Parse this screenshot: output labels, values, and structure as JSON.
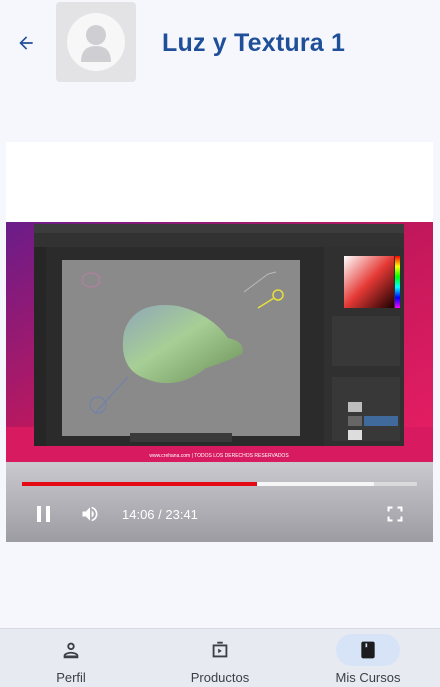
{
  "header": {
    "title": "Luz y Textura 1",
    "back_icon": "arrow-back-icon",
    "avatar_icon": "person-placeholder-icon"
  },
  "video": {
    "current_time": "14:06",
    "duration": "23:41",
    "time_display": "14:06 / 23:41",
    "progress_fraction": 0.595,
    "buffered_fraction": 0.89,
    "state": "playing",
    "footer_caption": "www.crehana.com | TODOS LOS DERECHOS RESERVADOS"
  },
  "bottom_nav": {
    "items": [
      {
        "label": "Perfil",
        "icon": "person-icon",
        "active": false
      },
      {
        "label": "Productos",
        "icon": "video-library-icon",
        "active": false
      },
      {
        "label": "Mis Cursos",
        "icon": "book-icon",
        "active": true
      }
    ]
  },
  "colors": {
    "title": "#1f4f98",
    "accent_red": "#e50914",
    "nav_active_pill": "#d7e3f7"
  }
}
